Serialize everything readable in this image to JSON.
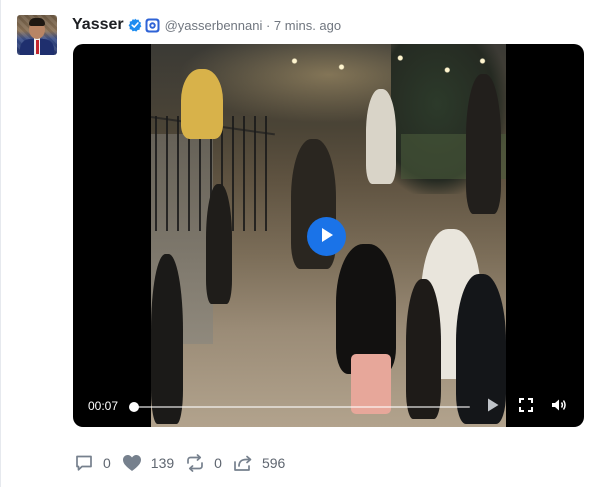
{
  "post": {
    "author_name": "Yasser",
    "handle_and_time": "@yasserbennani · 7 mins. ago"
  },
  "video": {
    "current_time": "00:07",
    "progress": 0.0
  },
  "actions": {
    "comments": "0",
    "likes": "139",
    "reposts": "0",
    "shares": "596"
  },
  "icons": {
    "verified": "verified-badge-icon",
    "affiliation": "affiliation-badge-icon",
    "play": "play-icon",
    "fullscreen": "fullscreen-icon",
    "volume": "volume-icon",
    "comment": "comment-icon",
    "like": "heart-icon",
    "repost": "repost-icon",
    "share": "share-icon"
  },
  "colors": {
    "accent": "#1a73e8",
    "name_text": "#1d1f23",
    "meta_text": "#70767f",
    "action_icon": "#76808d"
  }
}
